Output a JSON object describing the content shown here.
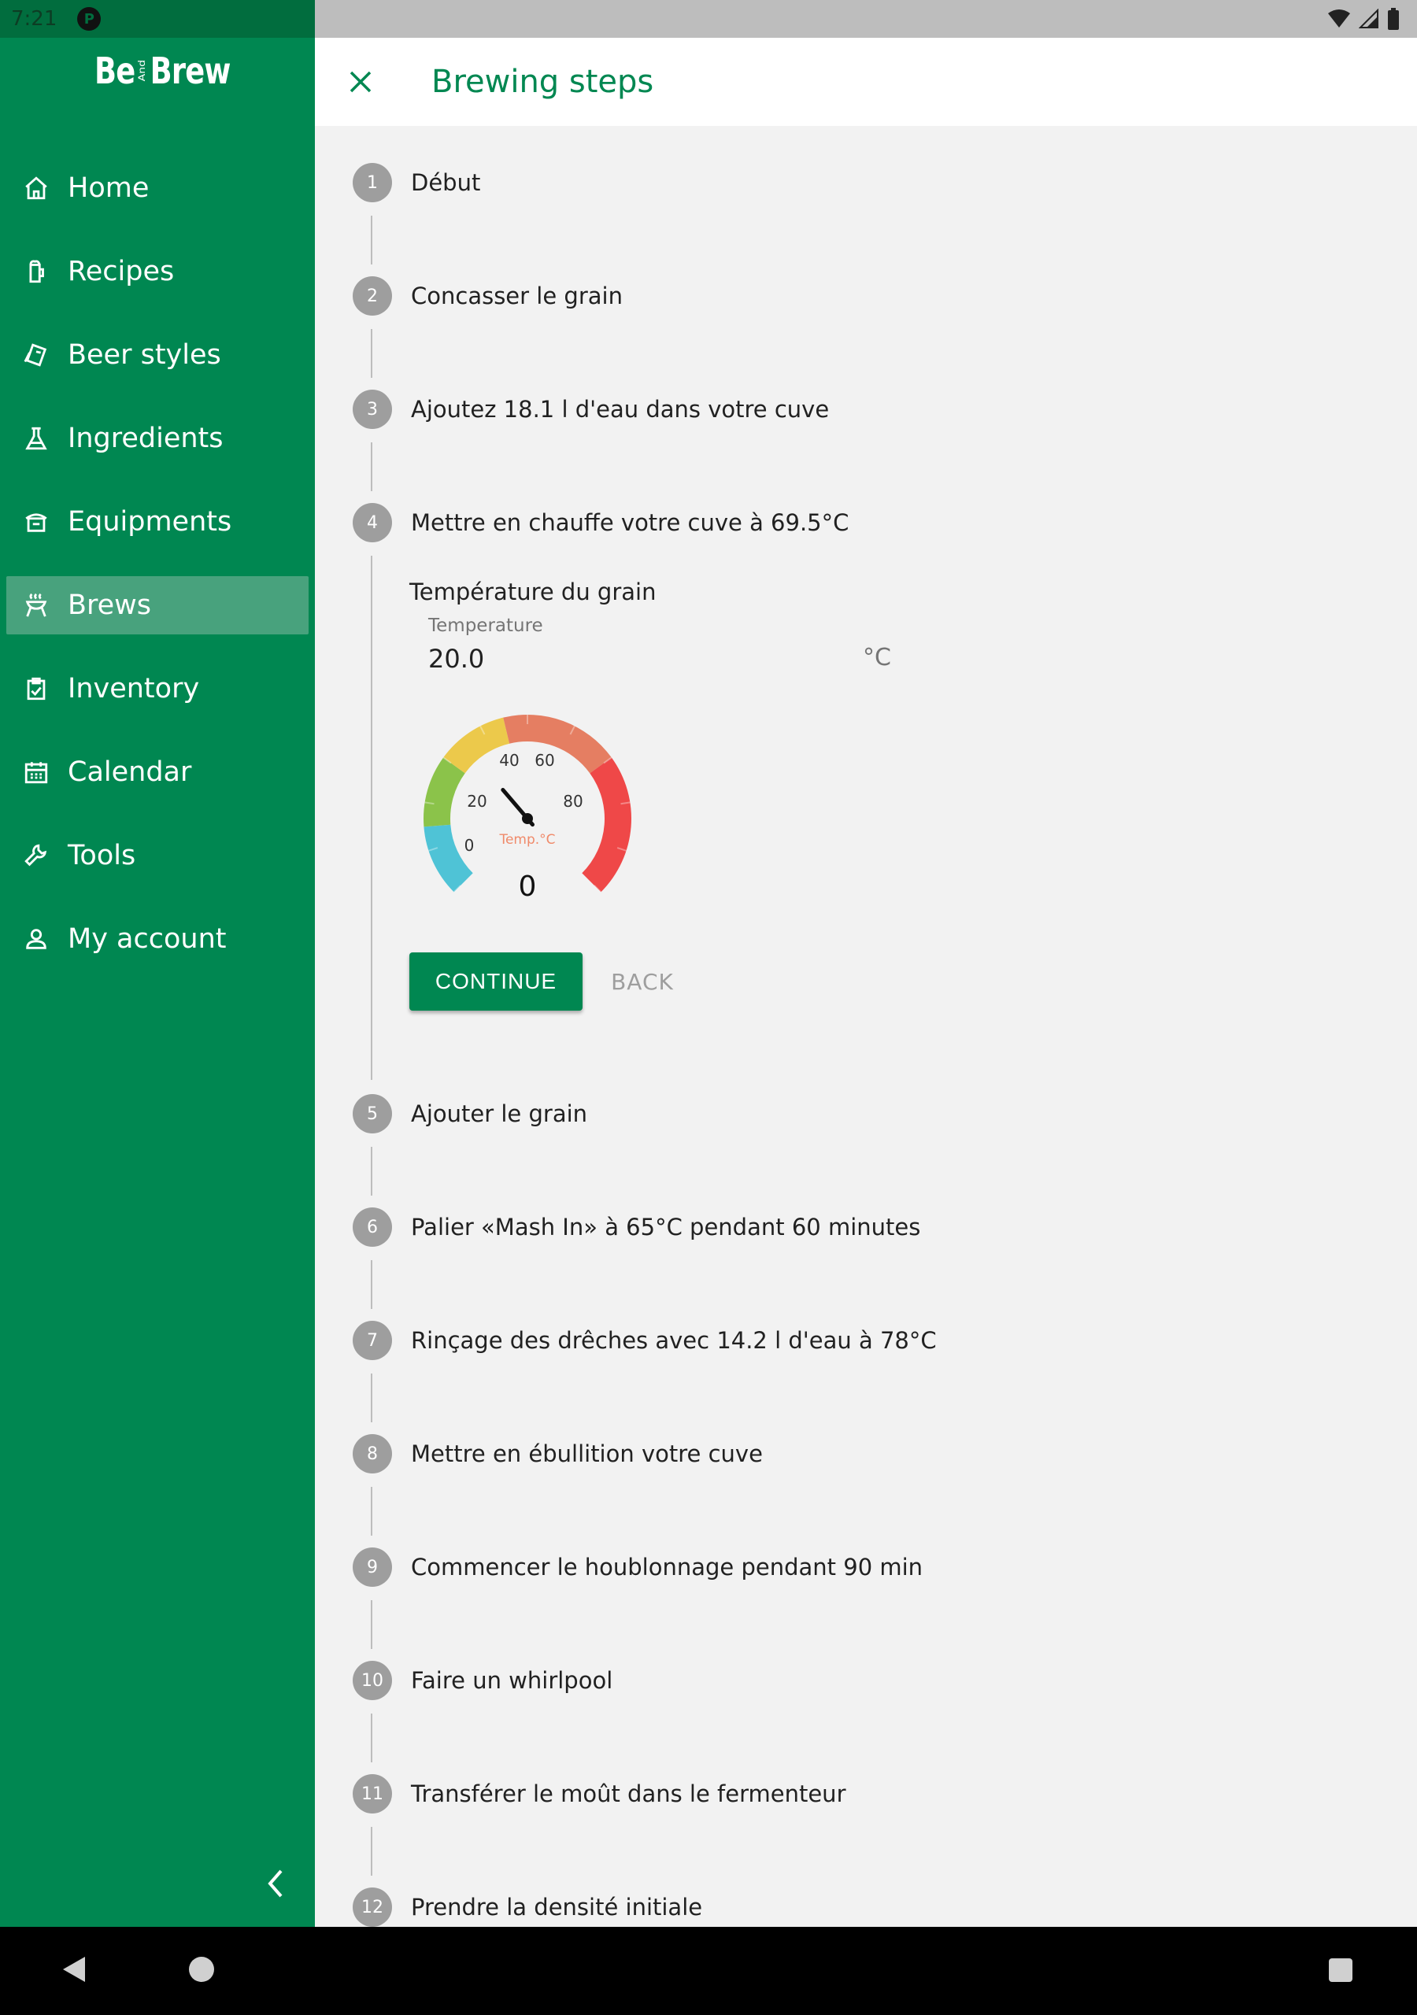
{
  "status_bar": {
    "time": "7:21"
  },
  "app": {
    "logo_left": "Be",
    "logo_and": "And",
    "logo_right": "Brew"
  },
  "sidebar": {
    "items": [
      {
        "label": "Home",
        "icon": "home-icon"
      },
      {
        "label": "Recipes",
        "icon": "recipes-icon"
      },
      {
        "label": "Beer styles",
        "icon": "beer-styles-icon"
      },
      {
        "label": "Ingredients",
        "icon": "flask-icon"
      },
      {
        "label": "Equipments",
        "icon": "equipment-icon"
      },
      {
        "label": "Brews",
        "icon": "brew-icon",
        "active": true
      },
      {
        "label": "Inventory",
        "icon": "inventory-icon"
      },
      {
        "label": "Calendar",
        "icon": "calendar-icon"
      },
      {
        "label": "Tools",
        "icon": "wrench-icon"
      },
      {
        "label": "My account",
        "icon": "account-icon"
      }
    ]
  },
  "header": {
    "title": "Brewing steps"
  },
  "steps": [
    {
      "number": "1",
      "title": "Début"
    },
    {
      "number": "2",
      "title": "Concasser le grain"
    },
    {
      "number": "3",
      "title": "Ajoutez 18.1 l d'eau dans votre cuve"
    },
    {
      "number": "4",
      "title": "Mettre en chauffe votre cuve à 69.5°C"
    },
    {
      "number": "5",
      "title": "Ajouter le grain"
    },
    {
      "number": "6",
      "title": "Palier «Mash In» à 65°C pendant 60 minutes"
    },
    {
      "number": "7",
      "title": "Rinçage des drêches avec 14.2 l d'eau à 78°C"
    },
    {
      "number": "8",
      "title": "Mettre en ébullition votre cuve"
    },
    {
      "number": "9",
      "title": "Commencer le houblonnage pendant 90 min"
    },
    {
      "number": "10",
      "title": "Faire un whirlpool"
    },
    {
      "number": "11",
      "title": "Transférer le moût dans le fermenteur"
    },
    {
      "number": "12",
      "title": "Prendre la densité initiale"
    }
  ],
  "active_step": {
    "subtitle": "Température du grain",
    "field_label": "Temperature",
    "field_value": "20.0",
    "field_unit": "°C",
    "gauge": {
      "ticks": [
        "0",
        "20",
        "40",
        "60",
        "80"
      ],
      "unit_label": "Temp.°C",
      "value_label": "0",
      "range": [
        0,
        100
      ],
      "needle_value": 35,
      "bands": [
        {
          "from": 0,
          "to": 15,
          "color": "#4fc3d6"
        },
        {
          "from": 15,
          "to": 30,
          "color": "#8bc34a"
        },
        {
          "from": 30,
          "to": 45,
          "color": "#ecc94b"
        },
        {
          "from": 45,
          "to": 70,
          "color": "#e57e62"
        },
        {
          "from": 70,
          "to": 100,
          "color": "#ef4848"
        }
      ]
    },
    "continue_label": "CONTINUE",
    "back_label": "BACK"
  },
  "colors": {
    "primary": "#008751",
    "active_item": "#48a27d",
    "status_bar_left": "#016d3e",
    "step_circle": "#9e9e9e"
  }
}
